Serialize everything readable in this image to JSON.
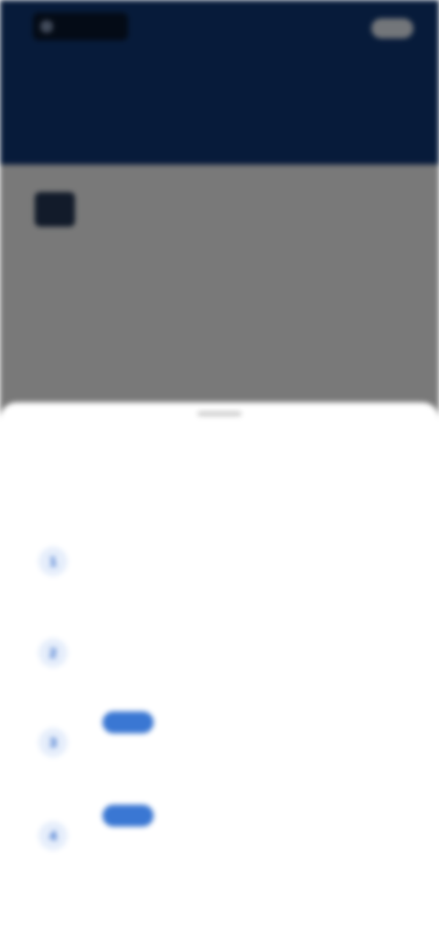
{
  "header": {
    "logo_text": "",
    "top_link": "",
    "top_button": "",
    "title": "",
    "subtitle": ""
  },
  "content": {
    "line": "",
    "heading": "",
    "subline": "",
    "link": ""
  },
  "sheet": {
    "title": "",
    "subtitle": "",
    "steps": [
      {
        "icon": "1",
        "title": "",
        "badge": "",
        "status": "",
        "green": "",
        "desc": ""
      },
      {
        "icon": "2",
        "title": "",
        "badge": "",
        "status": "",
        "green": "",
        "desc": ""
      },
      {
        "icon": "3",
        "title": "",
        "badge": "",
        "status": "",
        "green": "",
        "desc": ""
      },
      {
        "icon": "4",
        "title": "",
        "badge": "",
        "status": "",
        "green": "",
        "desc": ""
      }
    ]
  },
  "colors": {
    "header_bg": "#0f3774",
    "accent": "#3a77d3",
    "success": "#48a96a"
  }
}
